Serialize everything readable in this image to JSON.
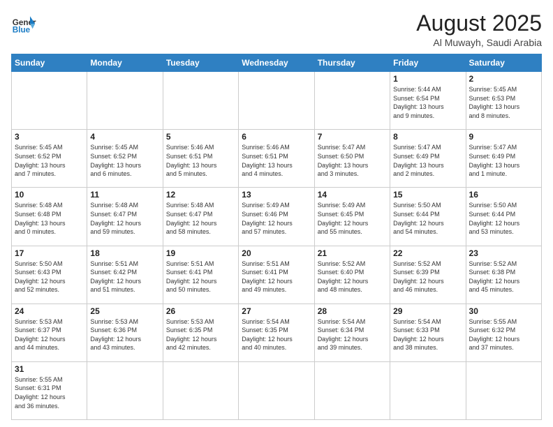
{
  "header": {
    "logo_general": "General",
    "logo_blue": "Blue",
    "month_title": "August 2025",
    "location": "Al Muwayh, Saudi Arabia"
  },
  "weekdays": [
    "Sunday",
    "Monday",
    "Tuesday",
    "Wednesday",
    "Thursday",
    "Friday",
    "Saturday"
  ],
  "weeks": [
    [
      {
        "day": "",
        "info": ""
      },
      {
        "day": "",
        "info": ""
      },
      {
        "day": "",
        "info": ""
      },
      {
        "day": "",
        "info": ""
      },
      {
        "day": "",
        "info": ""
      },
      {
        "day": "1",
        "info": "Sunrise: 5:44 AM\nSunset: 6:54 PM\nDaylight: 13 hours\nand 9 minutes."
      },
      {
        "day": "2",
        "info": "Sunrise: 5:45 AM\nSunset: 6:53 PM\nDaylight: 13 hours\nand 8 minutes."
      }
    ],
    [
      {
        "day": "3",
        "info": "Sunrise: 5:45 AM\nSunset: 6:52 PM\nDaylight: 13 hours\nand 7 minutes."
      },
      {
        "day": "4",
        "info": "Sunrise: 5:45 AM\nSunset: 6:52 PM\nDaylight: 13 hours\nand 6 minutes."
      },
      {
        "day": "5",
        "info": "Sunrise: 5:46 AM\nSunset: 6:51 PM\nDaylight: 13 hours\nand 5 minutes."
      },
      {
        "day": "6",
        "info": "Sunrise: 5:46 AM\nSunset: 6:51 PM\nDaylight: 13 hours\nand 4 minutes."
      },
      {
        "day": "7",
        "info": "Sunrise: 5:47 AM\nSunset: 6:50 PM\nDaylight: 13 hours\nand 3 minutes."
      },
      {
        "day": "8",
        "info": "Sunrise: 5:47 AM\nSunset: 6:49 PM\nDaylight: 13 hours\nand 2 minutes."
      },
      {
        "day": "9",
        "info": "Sunrise: 5:47 AM\nSunset: 6:49 PM\nDaylight: 13 hours\nand 1 minute."
      }
    ],
    [
      {
        "day": "10",
        "info": "Sunrise: 5:48 AM\nSunset: 6:48 PM\nDaylight: 13 hours\nand 0 minutes."
      },
      {
        "day": "11",
        "info": "Sunrise: 5:48 AM\nSunset: 6:47 PM\nDaylight: 12 hours\nand 59 minutes."
      },
      {
        "day": "12",
        "info": "Sunrise: 5:48 AM\nSunset: 6:47 PM\nDaylight: 12 hours\nand 58 minutes."
      },
      {
        "day": "13",
        "info": "Sunrise: 5:49 AM\nSunset: 6:46 PM\nDaylight: 12 hours\nand 57 minutes."
      },
      {
        "day": "14",
        "info": "Sunrise: 5:49 AM\nSunset: 6:45 PM\nDaylight: 12 hours\nand 55 minutes."
      },
      {
        "day": "15",
        "info": "Sunrise: 5:50 AM\nSunset: 6:44 PM\nDaylight: 12 hours\nand 54 minutes."
      },
      {
        "day": "16",
        "info": "Sunrise: 5:50 AM\nSunset: 6:44 PM\nDaylight: 12 hours\nand 53 minutes."
      }
    ],
    [
      {
        "day": "17",
        "info": "Sunrise: 5:50 AM\nSunset: 6:43 PM\nDaylight: 12 hours\nand 52 minutes."
      },
      {
        "day": "18",
        "info": "Sunrise: 5:51 AM\nSunset: 6:42 PM\nDaylight: 12 hours\nand 51 minutes."
      },
      {
        "day": "19",
        "info": "Sunrise: 5:51 AM\nSunset: 6:41 PM\nDaylight: 12 hours\nand 50 minutes."
      },
      {
        "day": "20",
        "info": "Sunrise: 5:51 AM\nSunset: 6:41 PM\nDaylight: 12 hours\nand 49 minutes."
      },
      {
        "day": "21",
        "info": "Sunrise: 5:52 AM\nSunset: 6:40 PM\nDaylight: 12 hours\nand 48 minutes."
      },
      {
        "day": "22",
        "info": "Sunrise: 5:52 AM\nSunset: 6:39 PM\nDaylight: 12 hours\nand 46 minutes."
      },
      {
        "day": "23",
        "info": "Sunrise: 5:52 AM\nSunset: 6:38 PM\nDaylight: 12 hours\nand 45 minutes."
      }
    ],
    [
      {
        "day": "24",
        "info": "Sunrise: 5:53 AM\nSunset: 6:37 PM\nDaylight: 12 hours\nand 44 minutes."
      },
      {
        "day": "25",
        "info": "Sunrise: 5:53 AM\nSunset: 6:36 PM\nDaylight: 12 hours\nand 43 minutes."
      },
      {
        "day": "26",
        "info": "Sunrise: 5:53 AM\nSunset: 6:35 PM\nDaylight: 12 hours\nand 42 minutes."
      },
      {
        "day": "27",
        "info": "Sunrise: 5:54 AM\nSunset: 6:35 PM\nDaylight: 12 hours\nand 40 minutes."
      },
      {
        "day": "28",
        "info": "Sunrise: 5:54 AM\nSunset: 6:34 PM\nDaylight: 12 hours\nand 39 minutes."
      },
      {
        "day": "29",
        "info": "Sunrise: 5:54 AM\nSunset: 6:33 PM\nDaylight: 12 hours\nand 38 minutes."
      },
      {
        "day": "30",
        "info": "Sunrise: 5:55 AM\nSunset: 6:32 PM\nDaylight: 12 hours\nand 37 minutes."
      }
    ],
    [
      {
        "day": "31",
        "info": "Sunrise: 5:55 AM\nSunset: 6:31 PM\nDaylight: 12 hours\nand 36 minutes."
      },
      {
        "day": "",
        "info": ""
      },
      {
        "day": "",
        "info": ""
      },
      {
        "day": "",
        "info": ""
      },
      {
        "day": "",
        "info": ""
      },
      {
        "day": "",
        "info": ""
      },
      {
        "day": "",
        "info": ""
      }
    ]
  ]
}
